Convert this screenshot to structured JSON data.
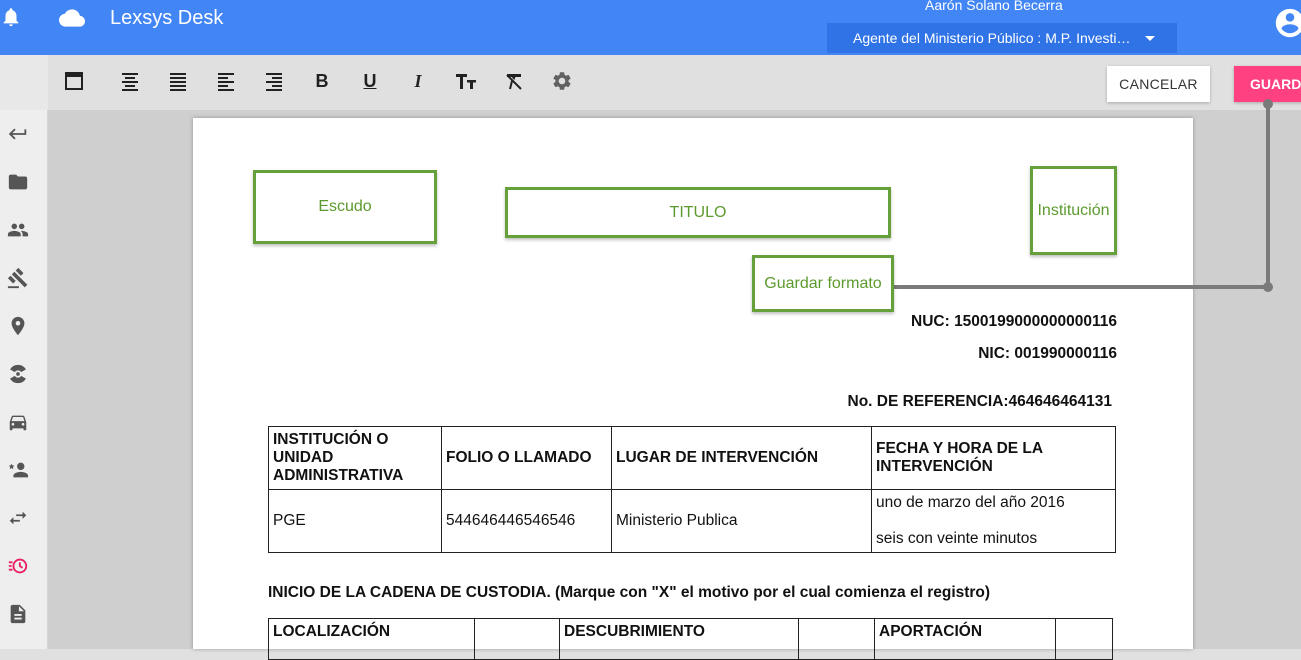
{
  "app": {
    "title": "Lexsys Desk"
  },
  "header": {
    "user_name": "Aarón Solano Becerra",
    "role": "Agente del Ministerio Público : M.P. Investi…"
  },
  "toolbar": {
    "icons": [
      "border-icon",
      "align-center-icon",
      "align-justify-icon",
      "align-left-icon",
      "align-right-icon",
      "bold-icon",
      "underline-icon",
      "italic-icon",
      "text-size-icon",
      "clear-format-icon",
      "settings-gear-icon"
    ],
    "bold_glyph": "B",
    "underline_glyph": "U",
    "italic_glyph": "I",
    "cancel_label": "CANCELAR",
    "save_label": "GUARDAR"
  },
  "sidebar": {
    "items": [
      "back-arrow-icon",
      "folder-icon",
      "people-icon",
      "gavel-icon",
      "location-pin-icon",
      "radiation-icon",
      "car-icon",
      "person-star-icon",
      "swap-arrows-icon",
      "history-icon",
      "document-icon"
    ],
    "accent": "#e91e63"
  },
  "document": {
    "placeholders": {
      "escudo": "Escudo",
      "titulo": "TITULO",
      "institucion": "Institución",
      "guardar_formato": "Guardar formato"
    },
    "nuc": "NUC: 1500199000000000116",
    "nic": "NIC: 001990000116",
    "referencia": "No. DE REFERENCIA:464646464131",
    "table1": {
      "headers": [
        "INSTITUCIÓN O UNIDAD ADMINISTRATIVA",
        "FOLIO O LLAMADO",
        "LUGAR DE INTERVENCIÓN",
        "FECHA Y HORA DE LA INTERVENCIÓN"
      ],
      "row": {
        "institucion": "PGE",
        "folio": "544646446546546",
        "lugar": "Ministerio Publica",
        "fecha": "uno de marzo del año 2016",
        "hora": "seis con veinte minutos"
      }
    },
    "section_title": "INICIO DE LA CADENA DE CUSTODIA. (Marque con \"X\" el motivo por el cual comienza el registro)",
    "table2": {
      "headers": [
        "LOCALIZACIÓN",
        "",
        "DESCUBRIMIENTO",
        "",
        "APORTACIÓN",
        ""
      ]
    }
  },
  "colors": {
    "topbar": "#4285f4",
    "role_bar": "#2f73e6",
    "save_button": "#ff4081",
    "placeholder_border": "#66a03a"
  }
}
